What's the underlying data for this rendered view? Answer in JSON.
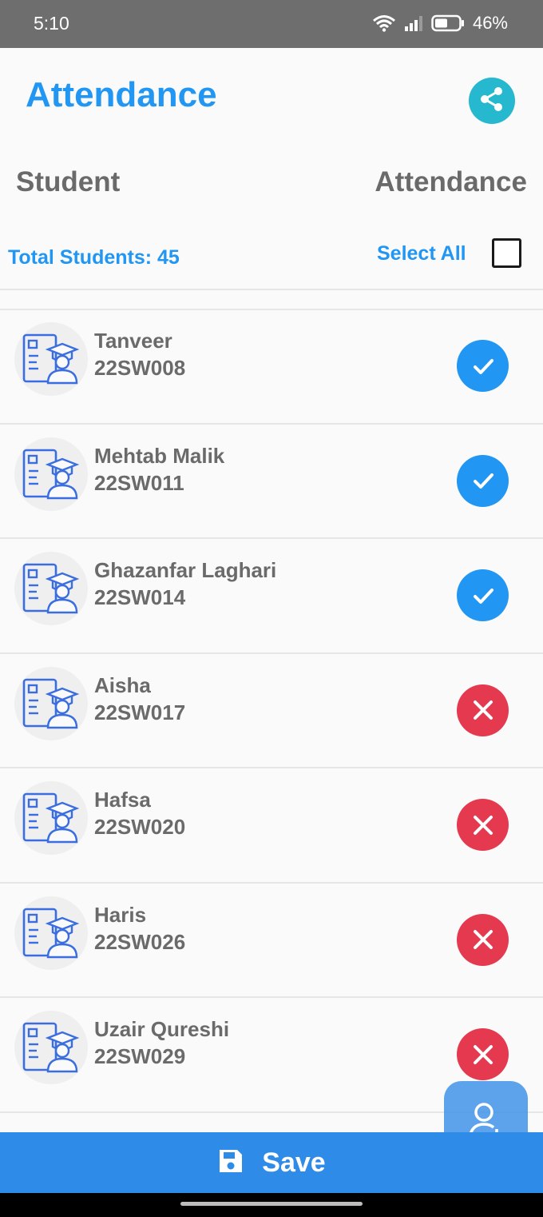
{
  "status_bar": {
    "time": "5:10",
    "battery": "46%",
    "icons": [
      "wifi-icon",
      "signal-icon",
      "battery-icon"
    ]
  },
  "header": {
    "title": "Attendance",
    "share_icon": "share-icon"
  },
  "columns": {
    "student": "Student",
    "attendance": "Attendance"
  },
  "summary": {
    "total_students": "Total Students: 45",
    "select_all": "Select All",
    "select_all_checked": false
  },
  "students": [
    {
      "name": "Tanveer",
      "roll": "22SW008",
      "status": "present"
    },
    {
      "name": "Mehtab Malik",
      "roll": "22SW011",
      "status": "present"
    },
    {
      "name": "Ghazanfar Laghari",
      "roll": "22SW014",
      "status": "present"
    },
    {
      "name": "Aisha",
      "roll": "22SW017",
      "status": "absent"
    },
    {
      "name": "Hafsa",
      "roll": "22SW020",
      "status": "absent"
    },
    {
      "name": "Haris",
      "roll": "22SW026",
      "status": "absent"
    },
    {
      "name": "Uzair Qureshi",
      "roll": "22SW029",
      "status": "absent"
    }
  ],
  "footer": {
    "save_label": "Save",
    "save_icon": "floppy-disk-icon",
    "fab_icon": "add-user-icon"
  },
  "colors": {
    "primary": "#2196f3",
    "present": "#2196f3",
    "absent": "#e53950",
    "share": "#26b8cf",
    "status_bar": "#6e6e6e"
  }
}
